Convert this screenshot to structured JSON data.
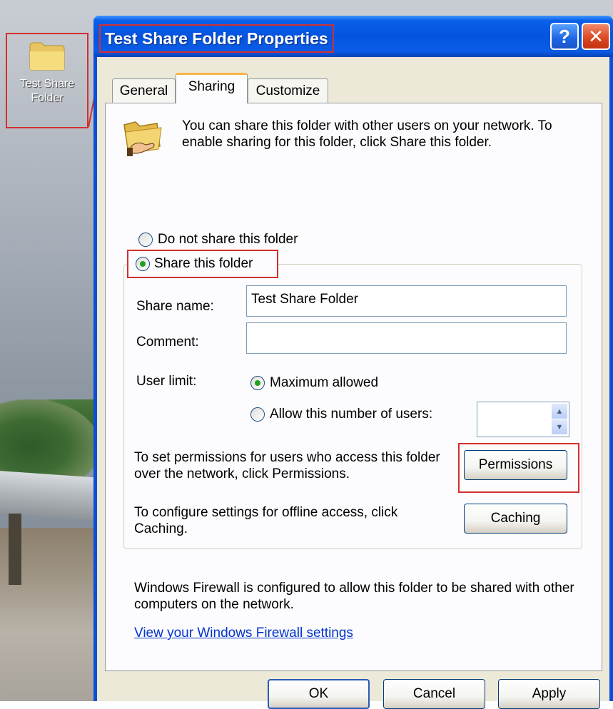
{
  "desktop": {
    "icon_label": "Test Share Folder"
  },
  "window": {
    "title": "Test Share Folder Properties",
    "help_label": "?",
    "close_label": "✕"
  },
  "tabs": [
    "General",
    "Sharing",
    "Customize"
  ],
  "sharing": {
    "intro": "You can share this folder with other users on your network.  To enable sharing for this folder, click Share this folder.",
    "do_not_share_label": "Do not share this folder",
    "do_not_share_checked": false,
    "share_label": "Share this folder",
    "share_checked": true,
    "share_name_label": "Share name:",
    "share_name_value": "Test Share Folder",
    "comment_label": "Comment:",
    "comment_value": "",
    "user_limit_label": "User limit:",
    "max_allowed_label": "Maximum allowed",
    "max_allowed_checked": true,
    "allow_number_label": "Allow this number of users:",
    "allow_number_checked": false,
    "allow_number_value": "",
    "permissions_text": "To set permissions for users who access this folder over the network, click Permissions.",
    "permissions_button": "Permissions",
    "caching_text": "To configure settings for offline access, click Caching.",
    "caching_button": "Caching",
    "firewall_text": "Windows Firewall is configured to allow this folder to be shared with other computers on the network.",
    "firewall_link": "View your Windows Firewall settings"
  },
  "footer": {
    "ok": "OK",
    "cancel": "Cancel",
    "apply": "Apply"
  },
  "colors": {
    "highlight": "#d23030",
    "titlebar": "#0554df",
    "dialog_bg": "#ece9d8",
    "link": "#0033cc"
  }
}
